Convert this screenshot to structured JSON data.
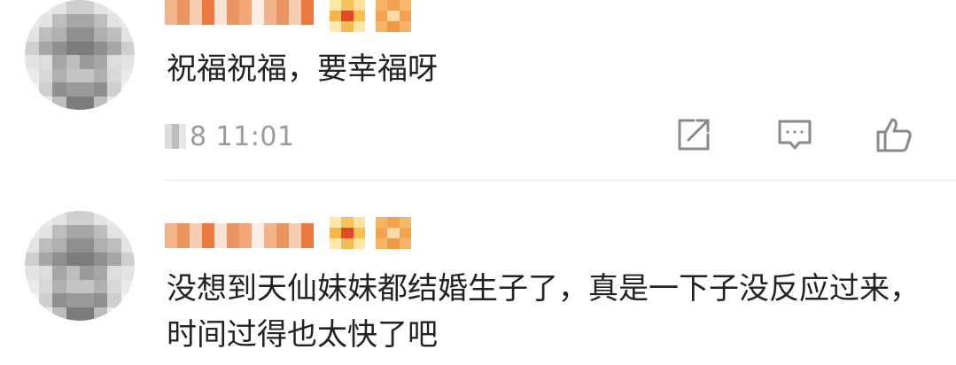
{
  "comments": [
    {
      "text": "祝福祝福，要幸福呀",
      "time": "8 11:01",
      "actions": {
        "share": "share-icon",
        "reply": "comment-icon",
        "like": "thumbs-up-icon"
      }
    },
    {
      "text": "没想到天仙妹妹都结婚生子了，真是一下子没反应过来，时间过得也太快了吧"
    }
  ],
  "colors": {
    "text": "#222222",
    "meta": "#9b9b9b",
    "icon": "#8a8a8a",
    "divider": "#e9e9e9"
  }
}
